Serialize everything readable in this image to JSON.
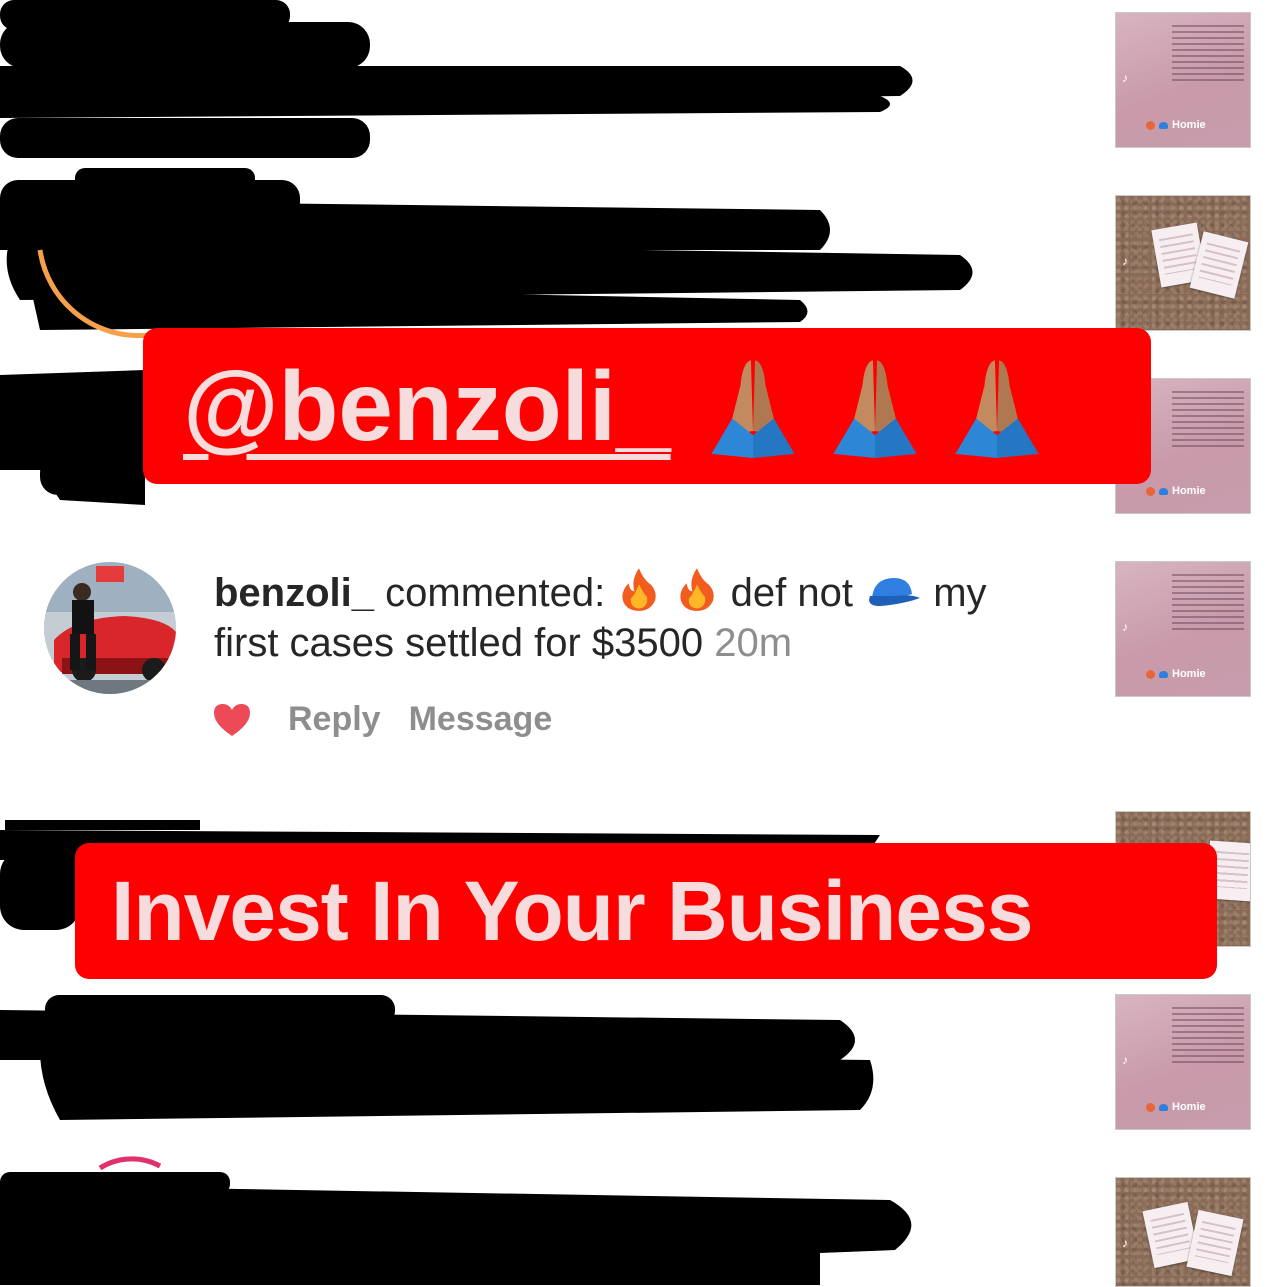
{
  "banners": {
    "top_mention": "@benzoli_",
    "bottom_slogan": "Invest In Your Business"
  },
  "comment": {
    "username": "benzoli_",
    "verb": "commented:",
    "text_part1": "def not",
    "text_part2": "my",
    "text_part3": "first cases settled for $3500",
    "time": "20m",
    "reply_label": "Reply",
    "message_label": "Message"
  },
  "thumbnails": [
    {
      "style": "document",
      "tag": "Homie"
    },
    {
      "style": "cork-board"
    },
    {
      "style": "document",
      "tag": "Homie"
    },
    {
      "style": "document",
      "tag": "Homie"
    },
    {
      "style": "cork-board"
    },
    {
      "style": "document",
      "tag": "Homie"
    },
    {
      "style": "cork-board"
    }
  ],
  "icons": {
    "mention_emoji": "folded-hands-icon",
    "comment_emoji_1": "fire-icon",
    "comment_emoji_2": "billed-cap-icon",
    "like": "heart-icon"
  },
  "colors": {
    "banner_red": "#ff0000",
    "banner_text": "#f6dcdc",
    "heart": "#ed4956",
    "muted": "#8e8e8e",
    "text": "#262626"
  }
}
